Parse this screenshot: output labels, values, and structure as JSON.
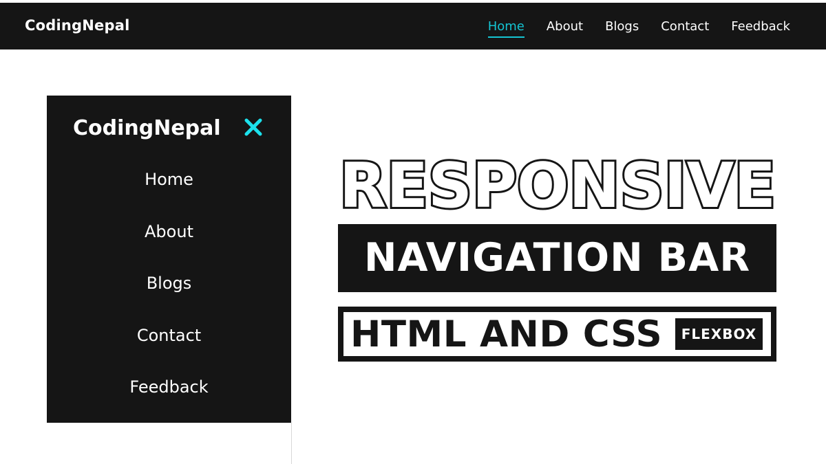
{
  "topbar": {
    "brand": "CodingNepal",
    "nav": [
      "Home",
      "About",
      "Blogs",
      "Contact",
      "Feedback"
    ],
    "active": "Home"
  },
  "sidemenu": {
    "brand": "CodingNepal",
    "close_icon": "close-icon",
    "links": [
      "Home",
      "About",
      "Blogs",
      "Contact",
      "Feedback"
    ]
  },
  "hero": {
    "line1": "RESPONSIVE",
    "line2": "NAVIGATION BAR",
    "line3": "HTML AND CSS",
    "badge": "FLEXBOX"
  },
  "colors": {
    "dark": "#151515",
    "accent": "#15c5d3",
    "close": "#1ce1ec",
    "background": "#ffffff"
  }
}
